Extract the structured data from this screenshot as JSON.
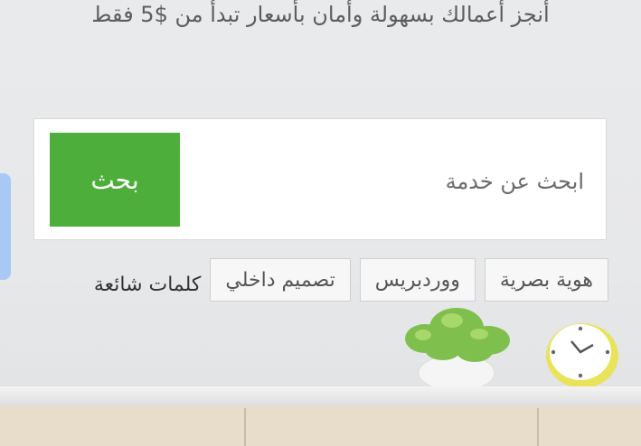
{
  "hero": {
    "tagline": "أنجز أعمالك بسهولة وأمان بأسعار تبدأ من $5 فقط"
  },
  "search": {
    "placeholder": "ابحث عن خدمة",
    "button_label": "بحث"
  },
  "keywords": {
    "label": "كلمات شائعة",
    "items": [
      "تصميم داخلي",
      "ووردبريس",
      "هوية بصرية"
    ]
  },
  "colors": {
    "accent": "#4eae3b",
    "side_tab": "#a8c8f5"
  }
}
